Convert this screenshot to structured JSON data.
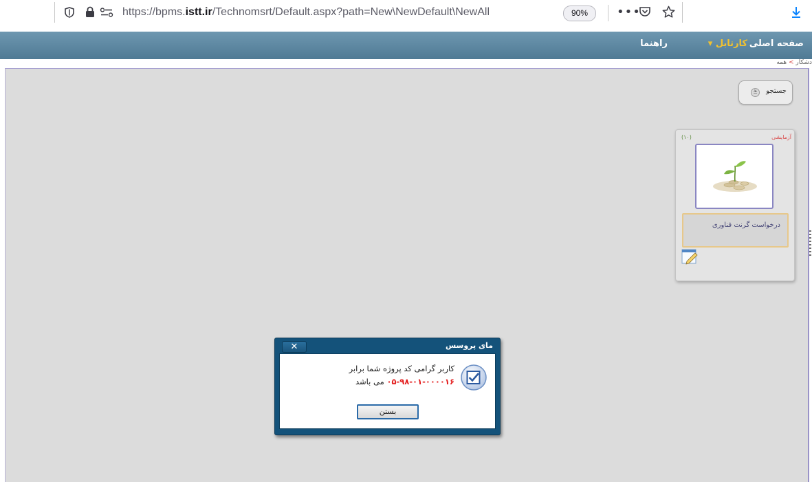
{
  "browser": {
    "url_prefix": "https://bpms.",
    "url_domain": "istt.ir",
    "url_path": "/Technomsrt/Default.aspx?path=New\\NewDefault\\NewAll",
    "zoom": "90%",
    "menu_glyph": "•••"
  },
  "header": {
    "home": "صفحه اصلی",
    "cartable": "کارتابل ▾",
    "guide": "راهنما"
  },
  "breadcrumb": {
    "part1": "دشکار",
    "sep": ">",
    "part2": "همه"
  },
  "search": {
    "label": "جستجو",
    "chevron": "≚"
  },
  "card": {
    "badge": "آزمایشی",
    "count": "(۱۰)",
    "title": "درخواست گرنت فناوری"
  },
  "dialog": {
    "title": "مای پروسس",
    "close": "✕",
    "line1": "کاربر گرامی کد پروژه شما برابر",
    "code": "۰۵-۹۸-۰۱-۰۰۰۰۱۶",
    "line2_suffix": "می باشد",
    "ok_label": "بستن"
  },
  "colors": {
    "header_bg": "#5b86a0",
    "cartable_accent": "#f2c230",
    "dialog_frame": "#14527a",
    "code_red": "#e31b1b"
  }
}
